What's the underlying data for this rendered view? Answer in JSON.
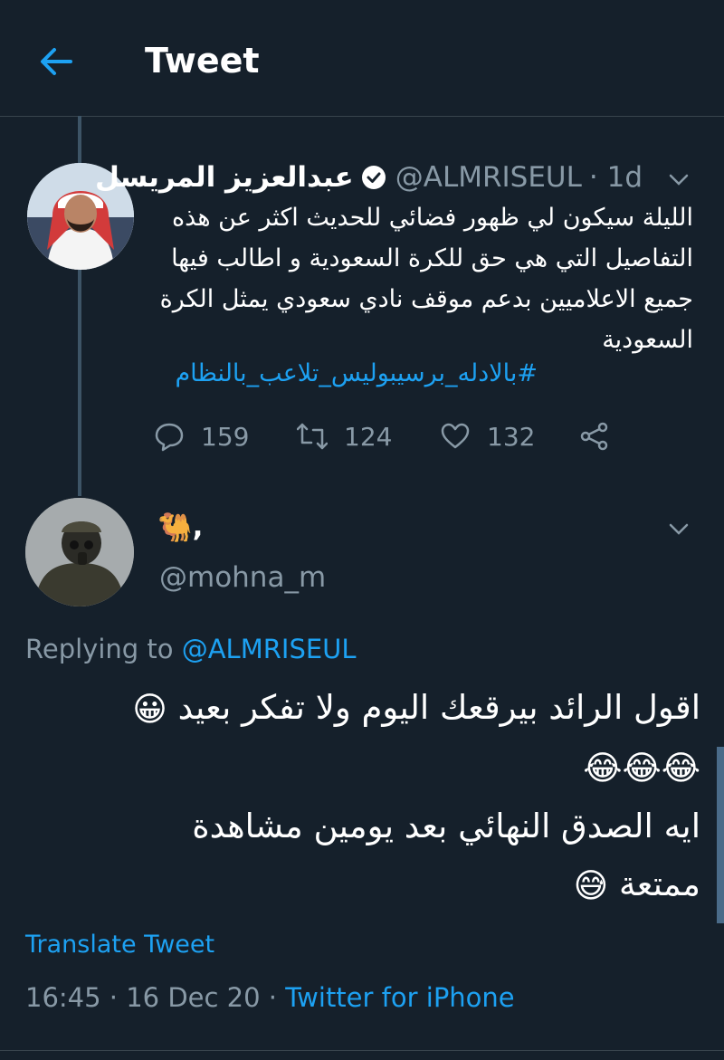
{
  "header": {
    "title": "Tweet",
    "back_icon": "arrow-left-icon"
  },
  "colors": {
    "background": "#15202b",
    "accent": "#1da1f2",
    "secondary_text": "#8899a6",
    "divider": "#38444d"
  },
  "tweet1": {
    "name": "عبدالعزيز المريسل",
    "verified_icon": "verified-badge-icon",
    "handle": "@ALMRISEUL",
    "time": "· 1d",
    "text": "الليلة سيكون لي ظهور فضائي للحديث اكثر عن هذه التفاصيل التي هي حق للكرة السعودية و اطالب فيها جميع الاعلاميين بدعم موقف نادي سعودي يمثل الكرة السعودية",
    "hashtag": "#بالادله_برسيبوليس_تلاعب_بالنظام",
    "replies": "159",
    "retweets": "124",
    "likes": "132"
  },
  "tweet2": {
    "name_emoji": "🐫",
    "name_suffix": ",",
    "handle": "@mohna_m",
    "replying_prefix": "Replying to",
    "replying_to": "@ALMRISEUL",
    "line1": "اقول الرائد بيرقعك اليوم ولا تفكر بعيد",
    "line3": "ايه الصدق النهائي بعد يومين مشاهدة",
    "line4": "ممتعة",
    "emoji_grin": "😀",
    "emoji_laugh": "😂",
    "emoji_smile": "😅",
    "translate": "Translate Tweet",
    "timestamp": "16:45 · 16 Dec 20 ·",
    "source": "Twitter for iPhone"
  }
}
